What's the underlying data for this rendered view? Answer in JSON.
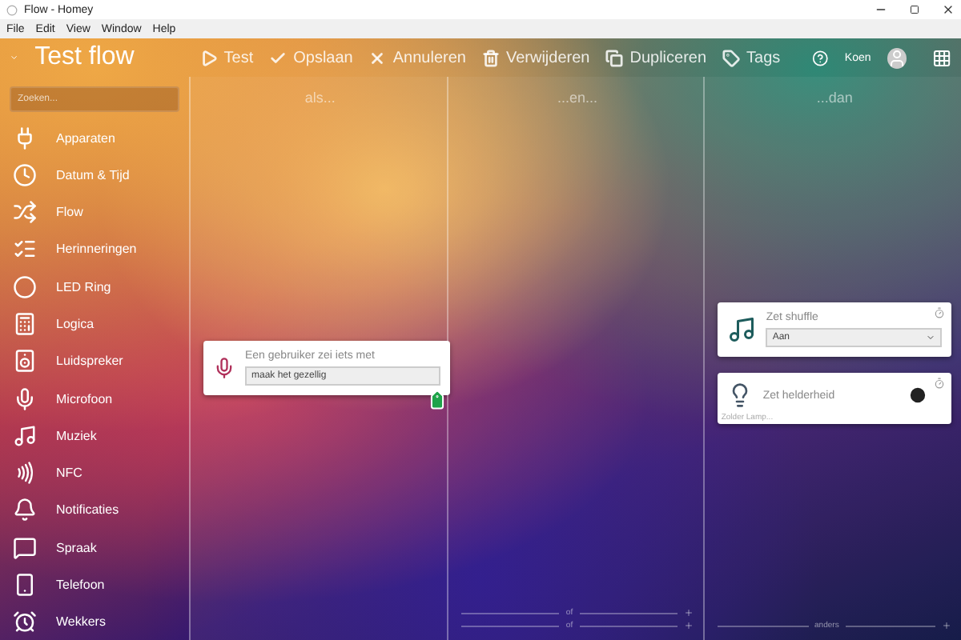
{
  "window": {
    "title": "Flow - Homey"
  },
  "menu": [
    "File",
    "Edit",
    "View",
    "Window",
    "Help"
  ],
  "header": {
    "flow_name": "Test flow",
    "actions": [
      {
        "label": "Test",
        "kind": "play"
      },
      {
        "label": "Opslaan",
        "kind": "check"
      },
      {
        "label": "Annuleren",
        "kind": "cancel"
      },
      {
        "label": "Verwijderen",
        "kind": "trash"
      },
      {
        "label": "Dupliceren",
        "kind": "copy"
      },
      {
        "label": "Tags",
        "kind": "tag"
      }
    ],
    "user": "Koen"
  },
  "sidebar": {
    "search": {
      "placeholder": "Zoeken..."
    },
    "items": [
      "Apparaten",
      "Datum & Tijd",
      "Flow",
      "Herinneringen",
      "LED Ring",
      "Logica",
      "Luidspreker",
      "Microfoon",
      "Muziek",
      "NFC",
      "Notificaties",
      "Spraak",
      "Telefoon",
      "Wekkers"
    ]
  },
  "columns": [
    {
      "title": "als...",
      "cards": [
        {
          "kind": "trigger",
          "title": "Een gebruiker zei iets met",
          "value": "maak het gezellig"
        }
      ]
    },
    {
      "title": "...en...",
      "footer": [
        "of",
        "of"
      ]
    },
    {
      "title": "...dan",
      "cards": [
        {
          "kind": "select",
          "title": "Zet shuffle",
          "value": "Aan"
        },
        {
          "kind": "device",
          "title": "Zet helderheid",
          "subtitle": "Zolder Lamp..."
        }
      ],
      "footer": [
        "anders"
      ]
    }
  ]
}
